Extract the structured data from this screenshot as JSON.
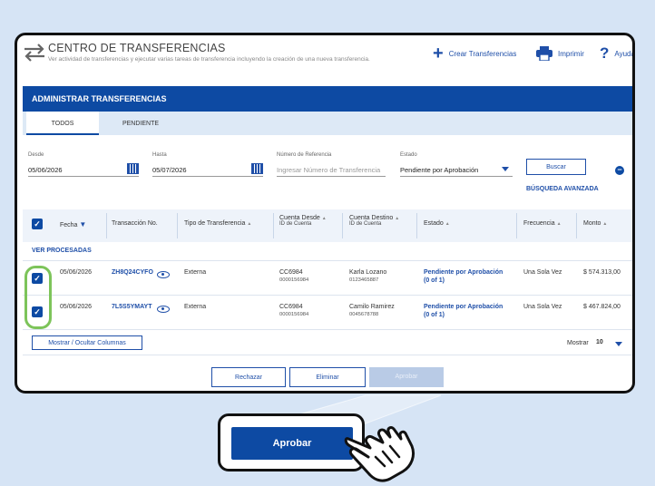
{
  "header": {
    "title": "CENTRO DE TRANSFERENCIAS",
    "subtitle": "Ver actividad de transferencias y ejecutar varias tareas de transferencia incluyendo la creación de una nueva transferencia.",
    "create_label": "Crear Transferencias",
    "print_label": "Imprimir",
    "help_label": "Ayuda"
  },
  "section_title": "ADMINISTRAR TRANSFERENCIAS",
  "tabs": [
    {
      "label": "TODOS",
      "active": true
    },
    {
      "label": "PENDIENTE",
      "active": false
    }
  ],
  "filters": {
    "from_label": "Desde",
    "from_value": "05/06/2026",
    "to_label": "Hasta",
    "to_value": "05/07/2026",
    "ref_label": "Número de Referencia",
    "ref_placeholder": "Ingresar Número de Transferencia",
    "status_label": "Estado",
    "status_value": "Pendiente por Aprobación",
    "search_label": "Buscar",
    "advanced_label": "BÚSQUEDA AVANZADA"
  },
  "table": {
    "headers": {
      "date": "Fecha",
      "transaction": "Transacción No.",
      "type": "Tipo de Transferencia",
      "from": "Cuenta Desde",
      "from_sub": "ID de Cuenta",
      "to": "Cuenta Destino",
      "to_sub": "ID de Cuenta",
      "status": "Estado",
      "frequency": "Frecuencia",
      "amount": "Monto"
    },
    "group_label": "VER PROCESADAS",
    "rows": [
      {
        "date": "05/06/2026",
        "transaction": "ZH8Q24CYFO",
        "type": "Externa",
        "from_account": "CC6984",
        "from_id": "0000156984",
        "to_name": "Karla Lozano",
        "to_id": "0123465887",
        "status": "Pendiente por Aprobación",
        "status_count": "(0 of 1)",
        "frequency": "Una Sola Vez",
        "amount": "$ 574.313,00"
      },
      {
        "date": "05/06/2026",
        "transaction": "7L5S5YMAYT",
        "type": "Externa",
        "from_account": "CC6984",
        "from_id": "0000156984",
        "to_name": "Camilo Ramirez",
        "to_id": "0045678788",
        "status": "Pendiente por Aprobación",
        "status_count": "(0 of 1)",
        "frequency": "Una Sola Vez",
        "amount": "$ 467.824,00"
      }
    ]
  },
  "columns_button": "Mostrar / Ocultar Columnas",
  "page_size_label": "Mostrar",
  "page_size_value": "10",
  "actions": {
    "reject": "Rechazar",
    "delete": "Eliminar",
    "approve_small": "Aprobar",
    "approve": "Aprobar"
  },
  "colors": {
    "primary": "#0d4aa3",
    "highlight": "#7dc45a",
    "background": "#d6e4f5"
  }
}
